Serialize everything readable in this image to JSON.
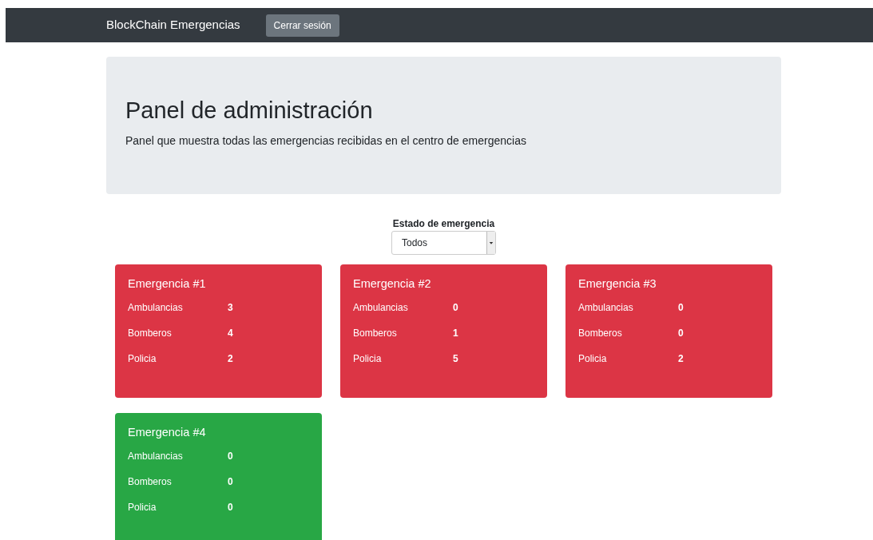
{
  "navbar": {
    "brand": "BlockChain Emergencias",
    "logout_button": "Cerrar sesión"
  },
  "header": {
    "title": "Panel de administración",
    "subtitle": "Panel que muestra todas las emergencias recibidas en el centro de emergencias"
  },
  "filter": {
    "label": "Estado de emergencia",
    "value": "Todos"
  },
  "emergencies": [
    {
      "title": "Emergencia #1",
      "color": "#dc3545",
      "rows": [
        {
          "label": "Ambulancias",
          "value": "3"
        },
        {
          "label": "Bomberos",
          "value": "4"
        },
        {
          "label": "Policia",
          "value": "2"
        }
      ]
    },
    {
      "title": "Emergencia #2",
      "color": "#dc3545",
      "rows": [
        {
          "label": "Ambulancias",
          "value": "0"
        },
        {
          "label": "Bomberos",
          "value": "1"
        },
        {
          "label": "Policia",
          "value": "5"
        }
      ]
    },
    {
      "title": "Emergencia #3",
      "color": "#dc3545",
      "rows": [
        {
          "label": "Ambulancias",
          "value": "0"
        },
        {
          "label": "Bomberos",
          "value": "0"
        },
        {
          "label": "Policia",
          "value": "2"
        }
      ]
    },
    {
      "title": "Emergencia #4",
      "color": "#28a745",
      "rows": [
        {
          "label": "Ambulancias",
          "value": "0"
        },
        {
          "label": "Bomberos",
          "value": "0"
        },
        {
          "label": "Policia",
          "value": "0"
        }
      ]
    }
  ]
}
